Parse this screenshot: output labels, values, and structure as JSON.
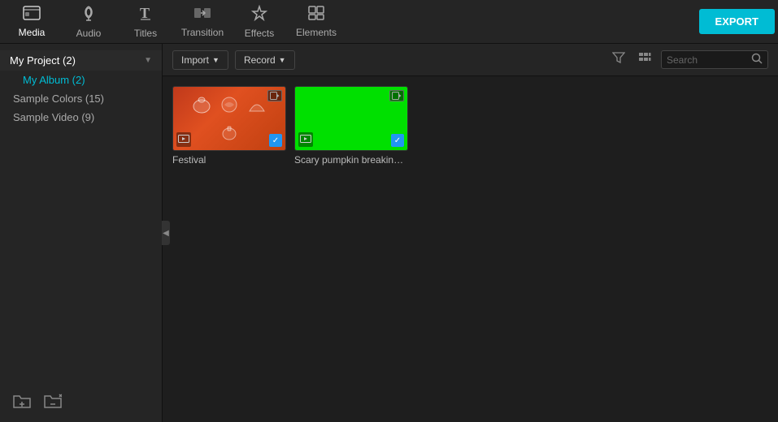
{
  "toolbar": {
    "export_label": "EXPORT",
    "items": [
      {
        "id": "media",
        "icon": "📁",
        "label": "Media"
      },
      {
        "id": "audio",
        "icon": "♪",
        "label": "Audio"
      },
      {
        "id": "titles",
        "icon": "T",
        "label": "Titles"
      },
      {
        "id": "transition",
        "icon": "⇌",
        "label": "Transition"
      },
      {
        "id": "effects",
        "icon": "✦",
        "label": "Effects"
      },
      {
        "id": "elements",
        "icon": "🖼",
        "label": "Elements"
      }
    ]
  },
  "sidebar": {
    "project_item": "My Project (2)",
    "album_item": "My Album (2)",
    "colors_item": "Sample Colors (15)",
    "video_item": "Sample Video (9)"
  },
  "content_toolbar": {
    "import_label": "Import",
    "record_label": "Record",
    "search_placeholder": "Search"
  },
  "media_items": [
    {
      "id": "festival",
      "label": "Festival",
      "type": "festival"
    },
    {
      "id": "scary-pumpkin",
      "label": "Scary pumpkin breaking s...",
      "type": "green"
    }
  ],
  "colors": {
    "accent": "#00bcd4",
    "checkmark": "#2196f3"
  }
}
